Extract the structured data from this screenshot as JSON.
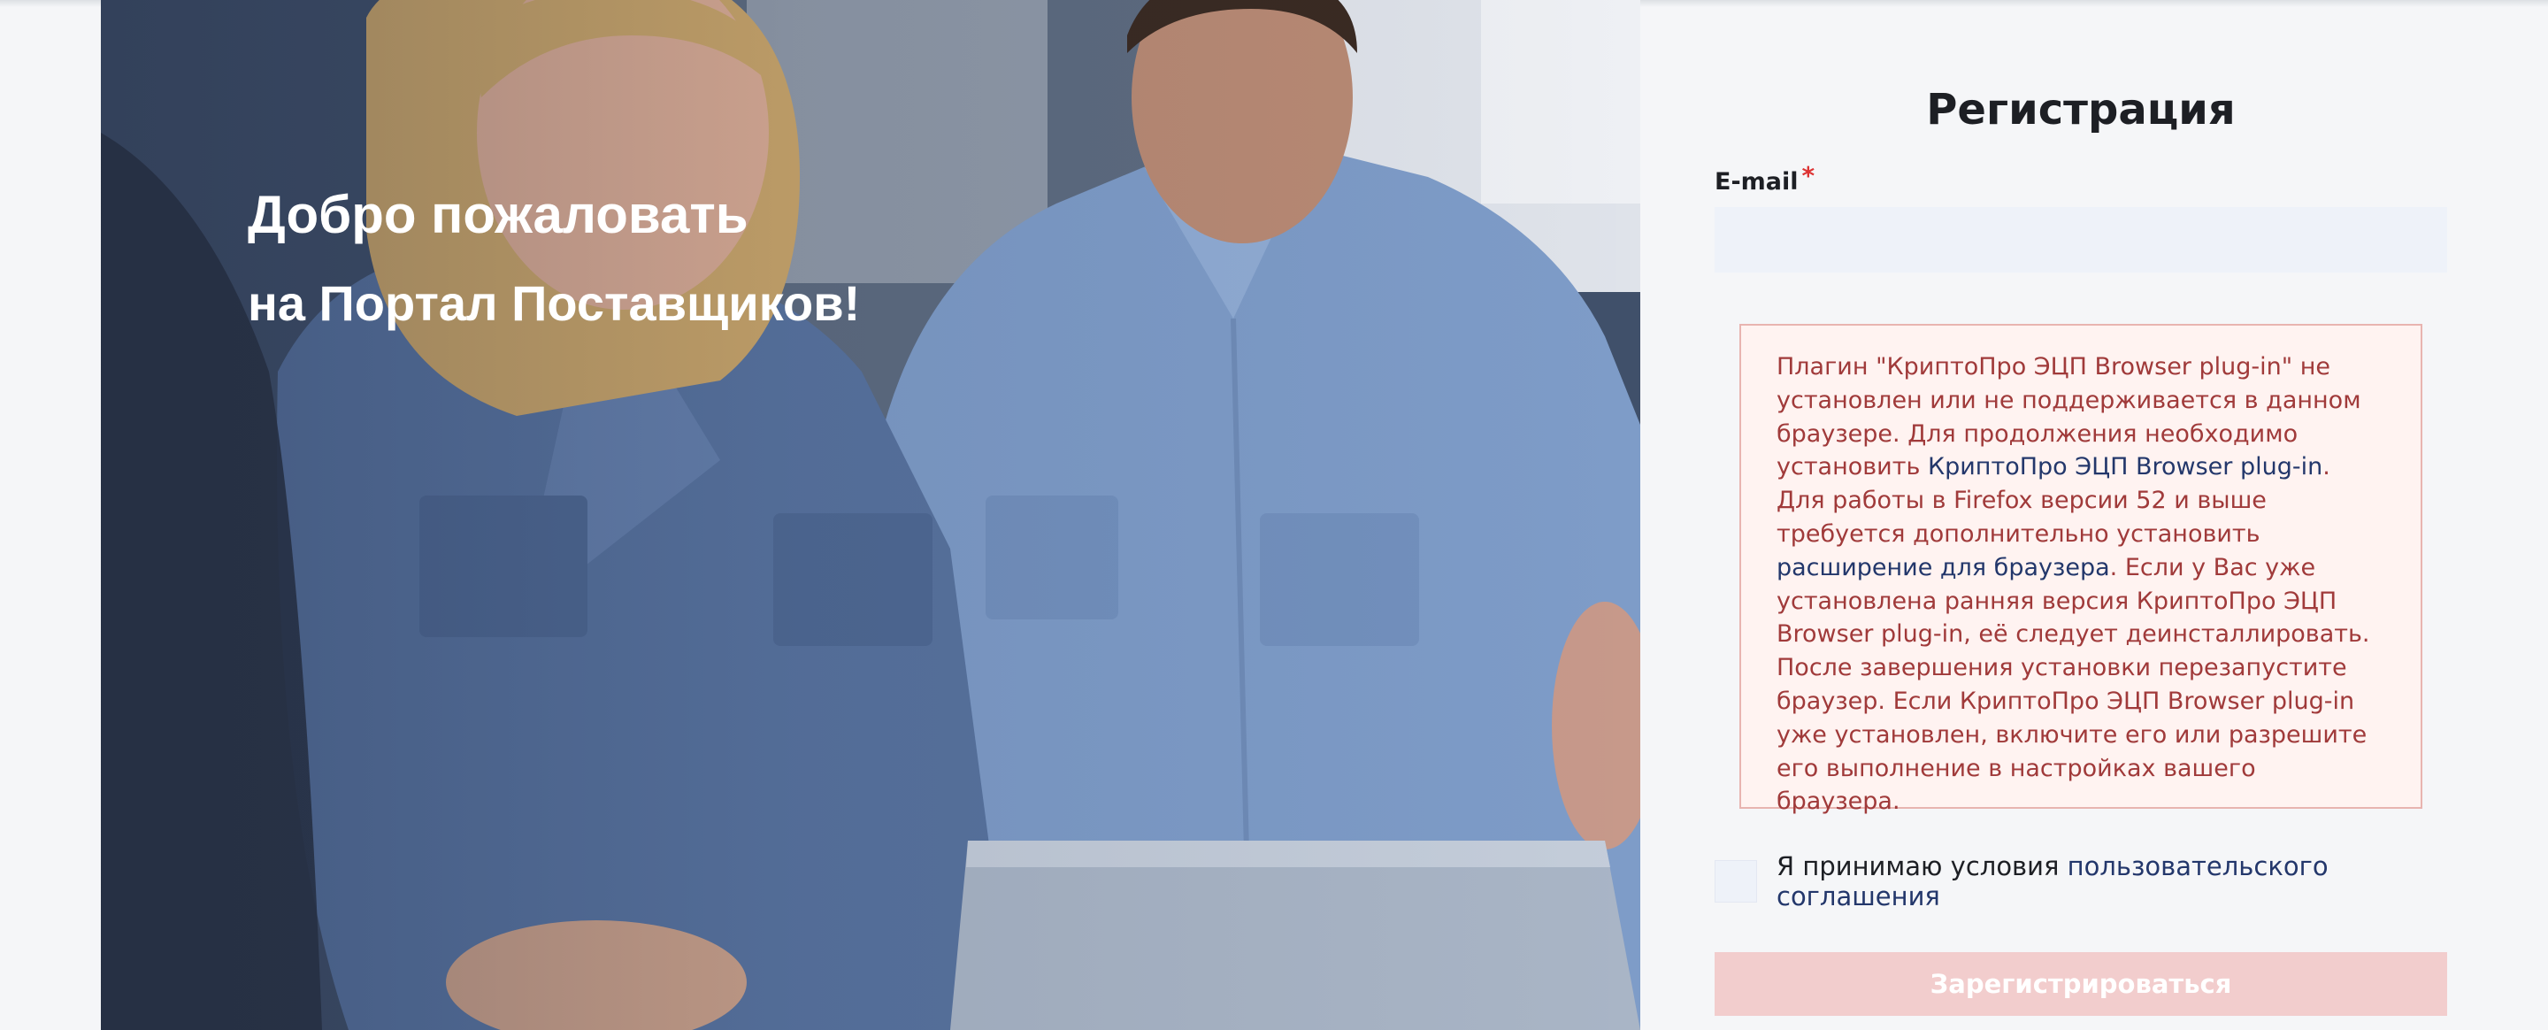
{
  "hero": {
    "title": "Добро пожаловать",
    "subtitle": "на Портал Поставщиков!"
  },
  "registration": {
    "title": "Регистрация",
    "email": {
      "label": "E-mail",
      "required_mark": "*",
      "value": "",
      "placeholder": ""
    },
    "plugin_alert": {
      "text_1": "Плагин \"КриптоПро ЭЦП Browser plug-in\" не установлен или не поддерживается в данном браузере. Для продолжения необходимо установить ",
      "link_plugin": "КриптоПро ЭЦП Browser plug-in",
      "text_2": ". Для работы в Firefox версии 52 и выше требуется дополнительно установить ",
      "link_extension": "расширение для браузера",
      "text_3": ". Если у Вас уже установлена ранняя версия КриптоПро ЭЦП Browser plug-in, её следует деинсталлировать. После завершения установки перезапустите браузер. Если КриптоПро ЭЦП Browser plug-in уже установлен, включите его или разрешите его выполнение в настройках вашего браузера."
    },
    "terms": {
      "checked": false,
      "text": "Я принимаю условия ",
      "link": "пользовательского соглашения"
    },
    "submit_label": "Зарегистрироваться"
  },
  "colors": {
    "alert_text": "#a03a3a",
    "alert_border": "#e8b4b0",
    "alert_background": "#fff3f1",
    "link": "#23376b",
    "input_background": "#eef2f9",
    "submit_disabled": "#f2cdcd"
  }
}
